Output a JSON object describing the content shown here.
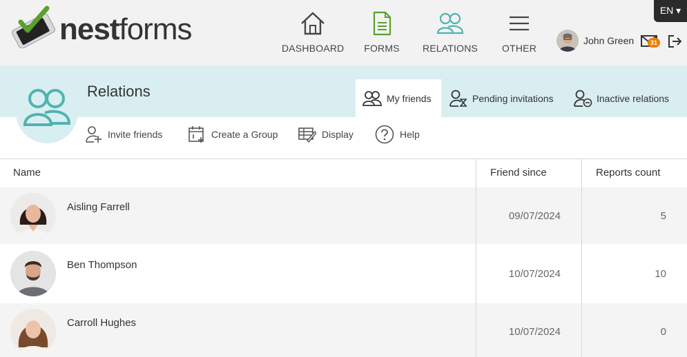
{
  "brand": {
    "logo_bold": "nest",
    "logo_light": "forms",
    "accent": "#4fb3b0",
    "check_green": "#5aa02c"
  },
  "nav": [
    {
      "label": "DASHBOARD",
      "icon": "home-icon"
    },
    {
      "label": "FORMS",
      "icon": "document-icon",
      "color": "#5aa02c"
    },
    {
      "label": "RELATIONS",
      "icon": "people-icon",
      "color": "#4fb3b0"
    },
    {
      "label": "OTHER",
      "icon": "hamburger-menu-icon"
    }
  ],
  "user": {
    "name": "John Green",
    "mail_count": "31"
  },
  "language": {
    "label": "EN ▾"
  },
  "page": {
    "title": "Relations"
  },
  "tabs": [
    {
      "label": "My friends",
      "icon": "people-outline-icon",
      "active": true
    },
    {
      "label": "Pending invitations",
      "icon": "person-hourglass-icon"
    },
    {
      "label": "Inactive relations",
      "icon": "person-minus-icon"
    }
  ],
  "toolbar": {
    "invite": "Invite friends",
    "group": "Create a Group",
    "display": "Display",
    "help": "Help"
  },
  "table": {
    "headers": {
      "name": "Name",
      "friend_since": "Friend since",
      "reports": "Reports count"
    },
    "rows": [
      {
        "name": "Aisling Farrell",
        "since": "09/07/2024",
        "reports": "5"
      },
      {
        "name": "Ben Thompson",
        "since": "10/07/2024",
        "reports": "10"
      },
      {
        "name": "Carroll Hughes",
        "since": "10/07/2024",
        "reports": "0"
      }
    ]
  }
}
